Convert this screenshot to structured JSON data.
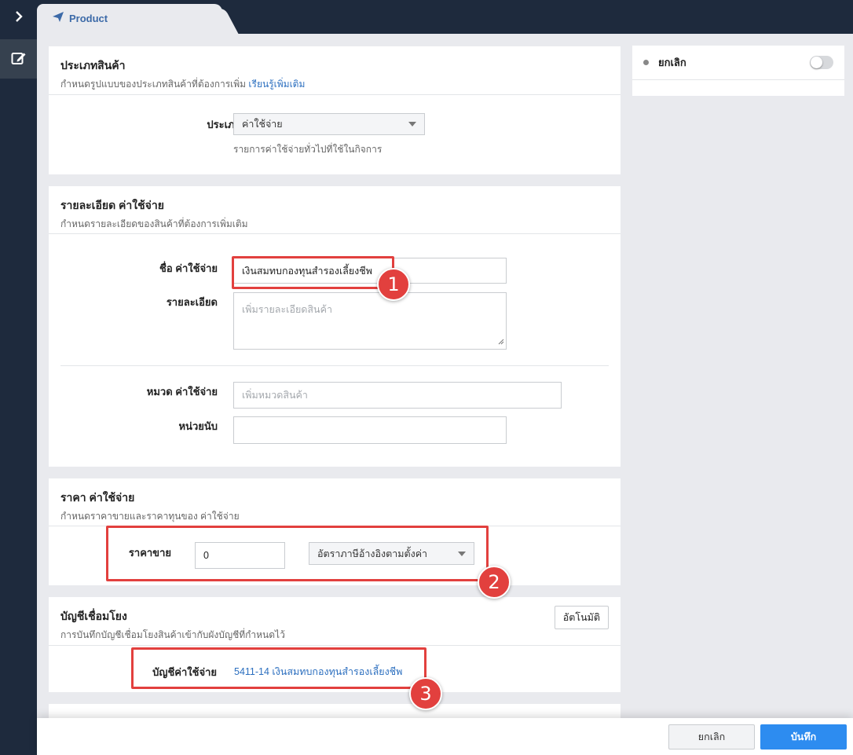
{
  "app": {
    "tab_label": "Product"
  },
  "section_type": {
    "title": "ประเภทสินค้า",
    "subtitle": "กำหนดรูปแบบของประเภทสินค้าที่ต้องการเพิ่ม",
    "learn_more": "เรียนรู้เพิ่มเติม",
    "field_label": "ประเภทสินค้า",
    "selected": "ค่าใช้จ่าย",
    "hint": "รายการค่าใช้จ่ายทั่วไปที่ใช้ในกิจการ"
  },
  "section_detail": {
    "title": "รายละเอียด ค่าใช้จ่าย",
    "subtitle": "กำหนดรายละเอียดของสินค้าที่ต้องการเพิ่มเติม",
    "name_label": "ชื่อ ค่าใช้จ่าย",
    "name_value": "เงินสมทบกองทุนสำรองเลี้ยงชีพ",
    "desc_label": "รายละเอียด",
    "desc_placeholder": "เพิ่มรายละเอียดสินค้า",
    "category_label": "หมวด ค่าใช้จ่าย",
    "category_placeholder": "เพิ่มหมวดสินค้า",
    "unit_label": "หน่วยนับ",
    "unit_value": ""
  },
  "section_price": {
    "title": "ราคา ค่าใช้จ่าย",
    "subtitle": "กำหนดราคาขายและราคาทุนของ ค่าใช้จ่าย",
    "price_label": "ราคาขาย",
    "price_value": "0",
    "tax_selected": "อัตราภาษีอ้างอิงตามตั้งค่า"
  },
  "section_account": {
    "title": "บัญชีเชื่อมโยง",
    "subtitle": "การบันทึกบัญชีเชื่อมโยงสินค้าเข้ากับผังบัญชีที่กำหนดไว้",
    "auto_button": "อัตโนมัติ",
    "account_label": "บัญชีค่าใช้จ่าย",
    "account_value": "5411-14 เงินสมทบกองทุนสำรองเลี้ยงชีพ"
  },
  "sidebar": {
    "cancel_label": "ยกเลิก",
    "toggle_on": false
  },
  "annotations": [
    "1",
    "2",
    "3"
  ],
  "footer": {
    "cancel": "ยกเลิก",
    "save": "บันทึก"
  },
  "colors": {
    "nav_bg": "#1e2a3d",
    "accent": "#2d8cf0",
    "highlight": "#e2403e",
    "link": "#2c6fbf"
  }
}
